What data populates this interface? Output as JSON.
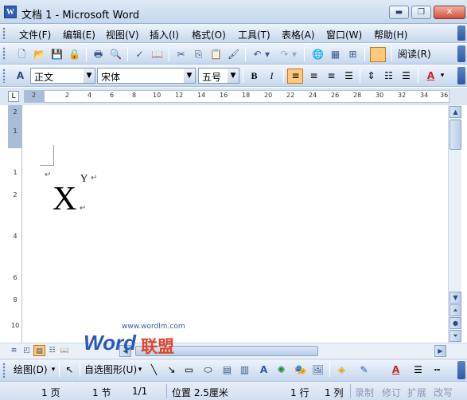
{
  "window": {
    "icon": "word-doc-icon",
    "title": "文档 1 - Microsoft Word",
    "min_glyph": "▬",
    "max_glyph": "❐",
    "close_glyph": "✕"
  },
  "menu": {
    "items": [
      "文件(F)",
      "编辑(E)",
      "视图(V)",
      "插入(I)",
      "格式(O)",
      "工具(T)",
      "表格(A)",
      "窗口(W)",
      "帮助(H)"
    ]
  },
  "toolbar": {
    "standard_icons": [
      "new-icon",
      "open-icon",
      "save-icon",
      "permission-icon",
      "print-icon",
      "print-preview-icon",
      "spelling-icon",
      "research-icon",
      "cut-icon",
      "copy-icon",
      "paste-icon",
      "format-painter-icon",
      "undo-icon",
      "redo-icon",
      "hyperlink-icon",
      "tables-borders-icon",
      "insert-table-icon",
      "drawing-icon"
    ],
    "read_label": "阅读(R)"
  },
  "formatting": {
    "style_value": "正文",
    "font_value": "宋体",
    "size_value": "五号",
    "bold": "B",
    "italic": "I",
    "font_color_glyph": "A"
  },
  "ruler": {
    "corner_glyph": "L",
    "h_labels": [
      "2",
      "2",
      "4",
      "6",
      "8",
      "10",
      "12",
      "14",
      "16",
      "18",
      "20",
      "22",
      "24",
      "26",
      "28",
      "30",
      "32",
      "34",
      "36"
    ],
    "v_labels": [
      "2",
      "1",
      "1",
      "2",
      "4",
      "6",
      "8",
      "10"
    ]
  },
  "document": {
    "base_char": "X",
    "superscript_char": "Y",
    "paragraph_mark": "↵"
  },
  "watermark": {
    "url": "www.wordlm.com",
    "brand": "Word",
    "brand_cn": "联盟"
  },
  "drawing_bar": {
    "draw_label": "绘图(D)",
    "autoshapes_label": "自选图形(U)"
  },
  "status": {
    "page": "1 页",
    "section": "1 节",
    "page_of": "1/1",
    "position": "位置 2.5厘米",
    "line": "1 行",
    "column": "1 列",
    "rec": "录制",
    "trk": "修订",
    "ext": "扩展",
    "ovr": "改写"
  }
}
